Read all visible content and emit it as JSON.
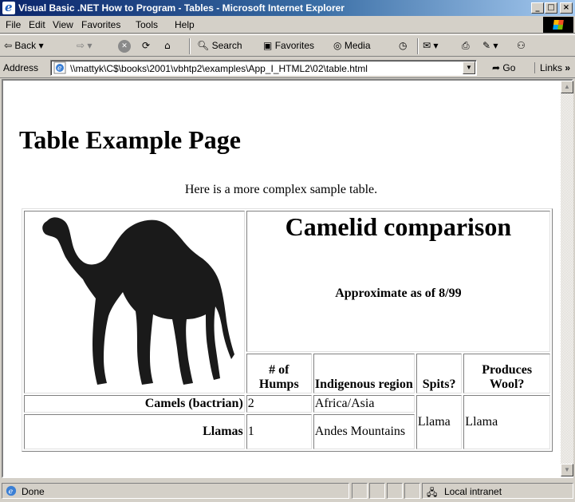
{
  "window": {
    "title": "Visual Basic .NET How to Program - Tables - Microsoft Internet Explorer"
  },
  "menu": [
    "File",
    "Edit",
    "View",
    "Favorites",
    "Tools",
    "Help"
  ],
  "toolbar": {
    "back": "Back",
    "search": "Search",
    "favorites": "Favorites",
    "media": "Media"
  },
  "address": {
    "label": "Address",
    "value": "\\\\mattyk\\C$\\books\\2001\\vbhtp2\\examples\\App_I_HTML2\\02\\table.html",
    "go": "Go",
    "links": "Links"
  },
  "page": {
    "heading": "Table Example Page",
    "caption": "Here is a more complex sample table.",
    "table": {
      "title": "Camelid comparison",
      "subtitle": "Approximate as of 8/99",
      "headers": [
        "# of Humps",
        "Indigenous region",
        "Spits?",
        "Produces Wool?"
      ],
      "rows": [
        {
          "name": "Camels (bactrian)",
          "humps": "2",
          "region": "Africa/Asia"
        },
        {
          "name": "Llamas",
          "humps": "1",
          "region": "Andes Mountains"
        }
      ],
      "spits": "Llama",
      "wool": "Llama"
    }
  },
  "status": {
    "text": "Done",
    "zone": "Local intranet"
  }
}
